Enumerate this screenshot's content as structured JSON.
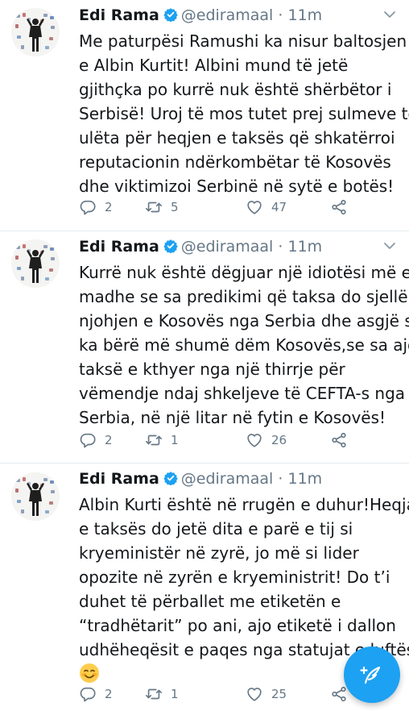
{
  "tweets": [
    {
      "name": "Edi Rama",
      "handle": "@ediramaal",
      "dot": "·",
      "time": "11m",
      "lines": [
        "Me paturpësi Ramushi ka nisur baltosjen",
        "e Albin Kurtit! Albini mund të jetë",
        "gjithçka po kurrë nuk është shërbëtor i",
        "Serbisë! Uroj të mos tutet prej sulmeve të",
        "ulëta për heqjen e taksës që shkatërroi",
        "reputacionin ndërkombëtar të Kosovës",
        "dhe viktimizoi Serbinë në sytë e botës!"
      ],
      "replies": "2",
      "retweets": "5",
      "likes": "47"
    },
    {
      "name": "Edi Rama",
      "handle": "@ediramaal",
      "dot": "·",
      "time": "11m",
      "lines": [
        "Kurrë nuk është dëgjuar një idiotësi më e",
        "madhe se sa predikimi që taksa do sjellë",
        "njohjen e Kosovës nga Serbia dhe asgjë s’i",
        "ka bërë më shumë dëm Kosovës,se sa ajo",
        "taksë e kthyer nga një thirrje për",
        "vëmendje ndaj shkeljeve të CEFTA-s nga",
        "Serbia, në një litar në fytin e Kosovës!"
      ],
      "replies": "2",
      "retweets": "1",
      "likes": "26"
    },
    {
      "name": "Edi Rama",
      "handle": "@ediramaal",
      "dot": "·",
      "time": "11m",
      "lines": [
        "Albin Kurti është në rrugën e duhur!Heqja",
        "e taksës do jetë dita e parë e tij si",
        "kryeministër në zyrë, jo më si lider",
        "opozite në zyrën e kryeministrit! Do t’i",
        "duhet të përballet me etiketën e",
        "“tradhëtarit” po ani, ajo etiketë i dallon",
        "udhëheqësit e paqes nga statujat e luftës"
      ],
      "emoji": "smiling-face-emoji",
      "replies": "2",
      "retweets": "1",
      "likes": "25"
    }
  ],
  "colors": {
    "accent": "#1da1f2",
    "text": "#14171a",
    "muted": "#657786",
    "divider": "#e6ecf0"
  },
  "icons": {
    "verified": "verified-badge-icon",
    "caret": "chevron-down-icon",
    "reply": "reply-icon",
    "retweet": "retweet-icon",
    "like": "heart-icon",
    "share": "share-icon",
    "compose": "compose-tweet-icon"
  }
}
